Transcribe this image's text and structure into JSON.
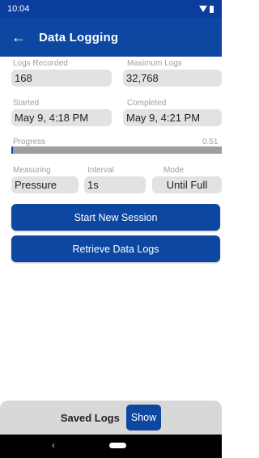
{
  "status_bar": {
    "time": "10:04",
    "icons": [
      "wifi-icon",
      "battery-icon"
    ]
  },
  "app_bar": {
    "back_icon": "arrow-left-icon",
    "title": "Data Logging"
  },
  "logs_recorded": {
    "label": "Logs Recorded",
    "value": "168"
  },
  "maximum_logs": {
    "label": "Maximum Logs",
    "value": "32,768"
  },
  "started": {
    "label": "Started",
    "value": "May 9, 4:18 PM"
  },
  "completed": {
    "label": "Completed",
    "value": "May 9, 4:21 PM"
  },
  "progress": {
    "label": "Progress",
    "value_text": "0.51",
    "fraction": 0.0051
  },
  "measuring": {
    "label": "Measuring",
    "value": "Pressure"
  },
  "interval": {
    "label": "Interval",
    "value": "1s"
  },
  "mode": {
    "label": "Mode",
    "value": "Until Full"
  },
  "buttons": {
    "start_session": "Start New Session",
    "retrieve_logs": "Retrieve Data Logs"
  },
  "saved_logs": {
    "label": "Saved Logs",
    "show_button": "Show"
  },
  "nav_bar": {
    "back_glyph": "‹"
  },
  "colors": {
    "primary": "#0d47a1",
    "status_bar": "#0b3d9e",
    "field_bg": "#e2e2e2",
    "label_gray": "#9e9e9e"
  }
}
